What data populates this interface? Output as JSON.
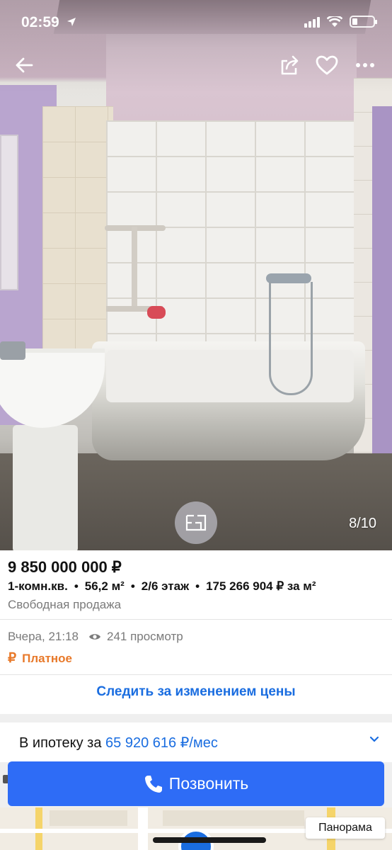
{
  "status_bar": {
    "time": "02:59"
  },
  "gallery": {
    "counter": "8/10"
  },
  "listing": {
    "price": "9 850 000 000 ₽",
    "specs": [
      "1-комн.кв.",
      "56,2 м²",
      "2/6 этаж",
      "175 266 904 ₽ за м²"
    ],
    "sale_type": "Свободная продажа",
    "date": "Вчера, 21:18",
    "views": "241 просмотр",
    "paid_label": "Платное",
    "paid_symbol": "₽"
  },
  "actions": {
    "track_price": "Следить за изменением цены",
    "mortgage_prefix": "В ипотеку за",
    "mortgage_amount": "65 920 616 ₽/мес",
    "call": "Позвонить"
  },
  "map": {
    "panorama": "Панорама"
  },
  "icons": {
    "back": "arrow-left-icon",
    "share": "share-icon",
    "favorite": "heart-icon",
    "more": "more-icon",
    "plan": "floor-plan-icon",
    "eye": "eye-icon",
    "phone": "phone-icon",
    "chevron": "chevron-down-icon"
  },
  "colors": {
    "accent": "#1a6de0",
    "button": "#2e6cf6",
    "paid": "#e8792a"
  }
}
